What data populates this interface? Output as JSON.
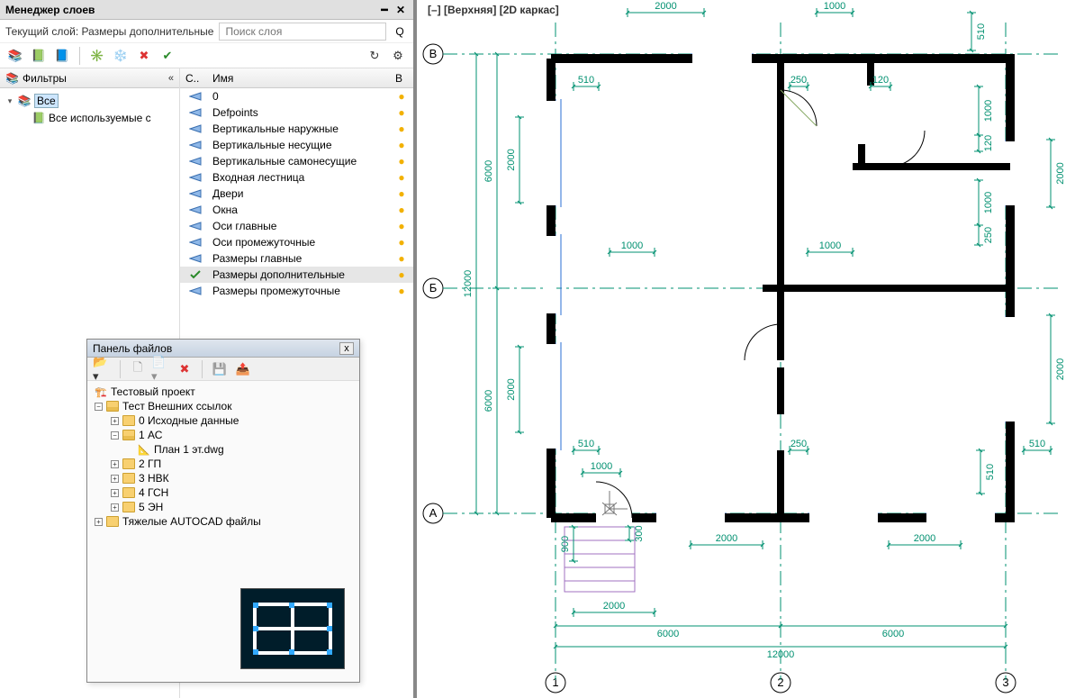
{
  "layer_manager": {
    "title": "Менеджер слоев",
    "current_label": "Текущий слой: Размеры дополнительные",
    "search_placeholder": "Поиск слоя",
    "q_icon": "Q",
    "filters_header": "Фильтры",
    "filter_all": "Все",
    "filter_used": "Все используемые с",
    "col_status": "С..",
    "col_name": "Имя",
    "col_vis": "В",
    "layers": [
      {
        "name": "0",
        "current": false
      },
      {
        "name": "Defpoints",
        "current": false
      },
      {
        "name": "Вертикальные наружные",
        "current": false
      },
      {
        "name": "Вертикальные несущие",
        "current": false
      },
      {
        "name": "Вертикальные самонесущие",
        "current": false
      },
      {
        "name": "Входная лестница",
        "current": false
      },
      {
        "name": "Двери",
        "current": false
      },
      {
        "name": "Окна",
        "current": false
      },
      {
        "name": "Оси главные",
        "current": false
      },
      {
        "name": "Оси промежуточные",
        "current": false
      },
      {
        "name": "Размеры главные",
        "current": false
      },
      {
        "name": "Размеры дополнительные",
        "current": true
      },
      {
        "name": "Размеры промежуточные",
        "current": false
      }
    ]
  },
  "files_panel": {
    "title": "Панель файлов",
    "tree": {
      "project": "Тестовый проект",
      "group1": "Тест Внешних ссылок",
      "children": [
        {
          "label": "0 Исходные данные",
          "open": false
        },
        {
          "label": "1 АС",
          "open": true,
          "file": "План 1 эт.dwg"
        },
        {
          "label": "2 ГП",
          "open": false
        },
        {
          "label": "3 НВК",
          "open": false
        },
        {
          "label": "4 ГСН",
          "open": false
        },
        {
          "label": "5 ЭН",
          "open": false
        }
      ],
      "group2": "Тяжелые AUTOCAD файлы"
    }
  },
  "viewport": {
    "label": "[–] [Верхняя] [2D каркас]",
    "axes": {
      "rows": [
        "А",
        "Б",
        "В"
      ],
      "cols": [
        "1",
        "2",
        "3"
      ]
    },
    "dimensions": {
      "top_inner": [
        "2000",
        "1000"
      ],
      "top_right_vert": "510",
      "row_b_inner": [
        "510",
        "250",
        "120"
      ],
      "row_b_right_verts": [
        "1000",
        "120",
        "1000",
        "250"
      ],
      "mid_inner": [
        "1000",
        "1000"
      ],
      "row_a_upper_inner": [
        "510",
        "250",
        "510"
      ],
      "row_a_upper_right_vert": "510",
      "bottom_inner1": [
        "1000",
        "2000",
        "2000"
      ],
      "bottom_inner2": [
        "2000"
      ],
      "bottom_main": [
        "6000",
        "6000"
      ],
      "bottom_total": "12000",
      "left_inner": [
        "2000",
        "2000"
      ],
      "left_main": [
        "6000",
        "6000"
      ],
      "left_total": "12000",
      "right_inner": [
        "2000",
        "2000"
      ],
      "stair": {
        "w": "900",
        "h": "300"
      }
    }
  }
}
